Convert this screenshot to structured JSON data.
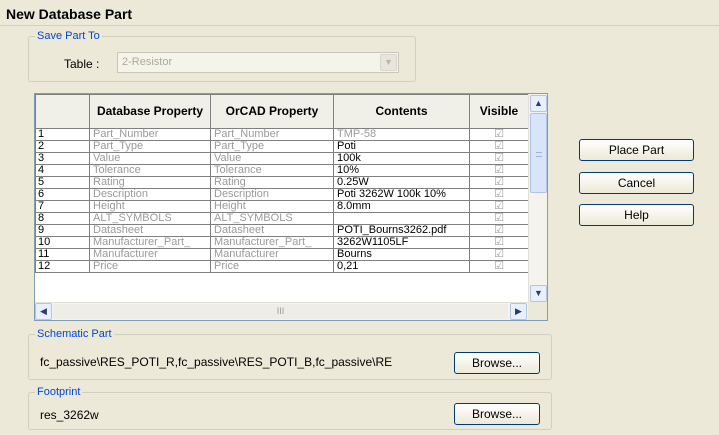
{
  "window": {
    "title": "New Database Part"
  },
  "save_part_to": {
    "legend": "Save Part To",
    "table_label": "Table :",
    "table_value": "2-Resistor"
  },
  "grid": {
    "headers": [
      "",
      "Database Property",
      "OrCAD Property",
      "Contents",
      "Visible"
    ],
    "rows": [
      {
        "num": "1",
        "db": "Part_Number",
        "orcad": "Part_Number",
        "contents": "TMP-58",
        "visible": "☑"
      },
      {
        "num": "2",
        "db": "Part_Type",
        "orcad": "Part_Type",
        "contents": "Poti",
        "visible": "☑"
      },
      {
        "num": "3",
        "db": "Value",
        "orcad": "Value",
        "contents": "100k",
        "visible": "☑"
      },
      {
        "num": "4",
        "db": "Tolerance",
        "orcad": "Tolerance",
        "contents": "10%",
        "visible": "☑"
      },
      {
        "num": "5",
        "db": "Rating",
        "orcad": "Rating",
        "contents": "0.25W",
        "visible": "☑"
      },
      {
        "num": "6",
        "db": "Description",
        "orcad": "Description",
        "contents": "Poti 3262W 100k 10%",
        "visible": "☑"
      },
      {
        "num": "7",
        "db": "Height",
        "orcad": "Height",
        "contents": "8.0mm",
        "visible": "☑"
      },
      {
        "num": "8",
        "db": "ALT_SYMBOLS",
        "orcad": "ALT_SYMBOLS",
        "contents": "",
        "visible": "☑"
      },
      {
        "num": "9",
        "db": "Datasheet",
        "orcad": "Datasheet",
        "contents": "POTI_Bourns3262.pdf",
        "visible": "☑"
      },
      {
        "num": "10",
        "db": "Manufacturer_Part_",
        "orcad": "Manufacturer_Part_",
        "contents": "3262W1105LF",
        "visible": "☑"
      },
      {
        "num": "11",
        "db": "Manufacturer",
        "orcad": "Manufacturer",
        "contents": "Bourns",
        "visible": "☑"
      },
      {
        "num": "12",
        "db": "Price",
        "orcad": "Price",
        "contents": "0,21",
        "visible": "☑"
      }
    ]
  },
  "buttons": {
    "place_part": "Place Part",
    "cancel": "Cancel",
    "help": "Help"
  },
  "schematic_part": {
    "legend": "Schematic Part",
    "value": "fc_passive\\RES_POTI_R,fc_passive\\RES_POTI_B,fc_passive\\RE",
    "browse": "Browse..."
  },
  "footprint": {
    "legend": "Footprint",
    "value": "res_3262w",
    "browse": "Browse..."
  },
  "icons": {
    "checkbox": "checkbox-checked-icon",
    "scroll_up": "▲",
    "scroll_down": "▼",
    "scroll_left": "◀",
    "scroll_right": "▶",
    "combo_arrow": "▼",
    "thumb_grip": "III"
  }
}
